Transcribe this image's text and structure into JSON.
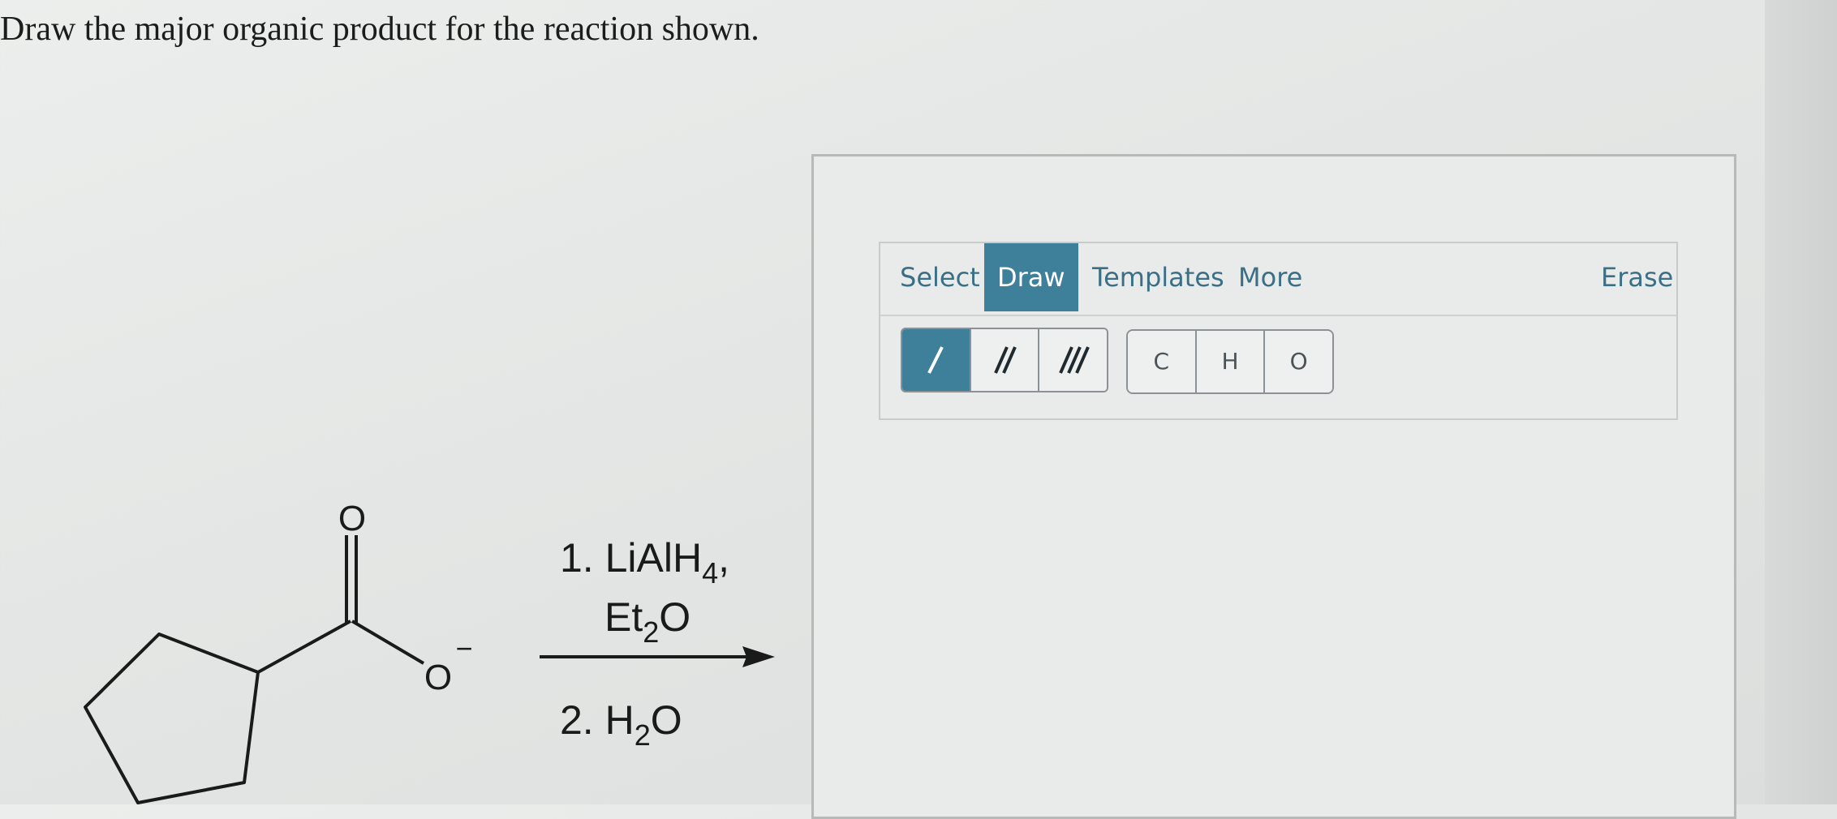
{
  "question": "Draw the major organic product for the reaction shown.",
  "molecule": {
    "carbonyl_o": "O",
    "anion_o": "O",
    "charge": "−"
  },
  "reagents": {
    "step1_prefix": "1. LiAlH",
    "step1_sub": "4",
    "step1_suffix": ",",
    "solvent_prefix": "Et",
    "solvent_sub": "2",
    "solvent_suffix": "O",
    "step2_prefix": "2. H",
    "step2_sub": "2",
    "step2_suffix": "O"
  },
  "editor": {
    "tabs": [
      {
        "label": "Select",
        "active": false
      },
      {
        "label": "Draw",
        "active": true
      },
      {
        "label": "Templates",
        "active": false
      },
      {
        "label": "More",
        "active": false
      }
    ],
    "erase_label": "Erase",
    "bond_tools": [
      {
        "icon": "single-bond-icon",
        "active": true
      },
      {
        "icon": "double-bond-icon",
        "active": false
      },
      {
        "icon": "triple-bond-icon",
        "active": false
      }
    ],
    "atoms": [
      "C",
      "H",
      "O"
    ]
  },
  "colors": {
    "accent": "#3e7f99",
    "tab_text": "#3a6f86"
  }
}
